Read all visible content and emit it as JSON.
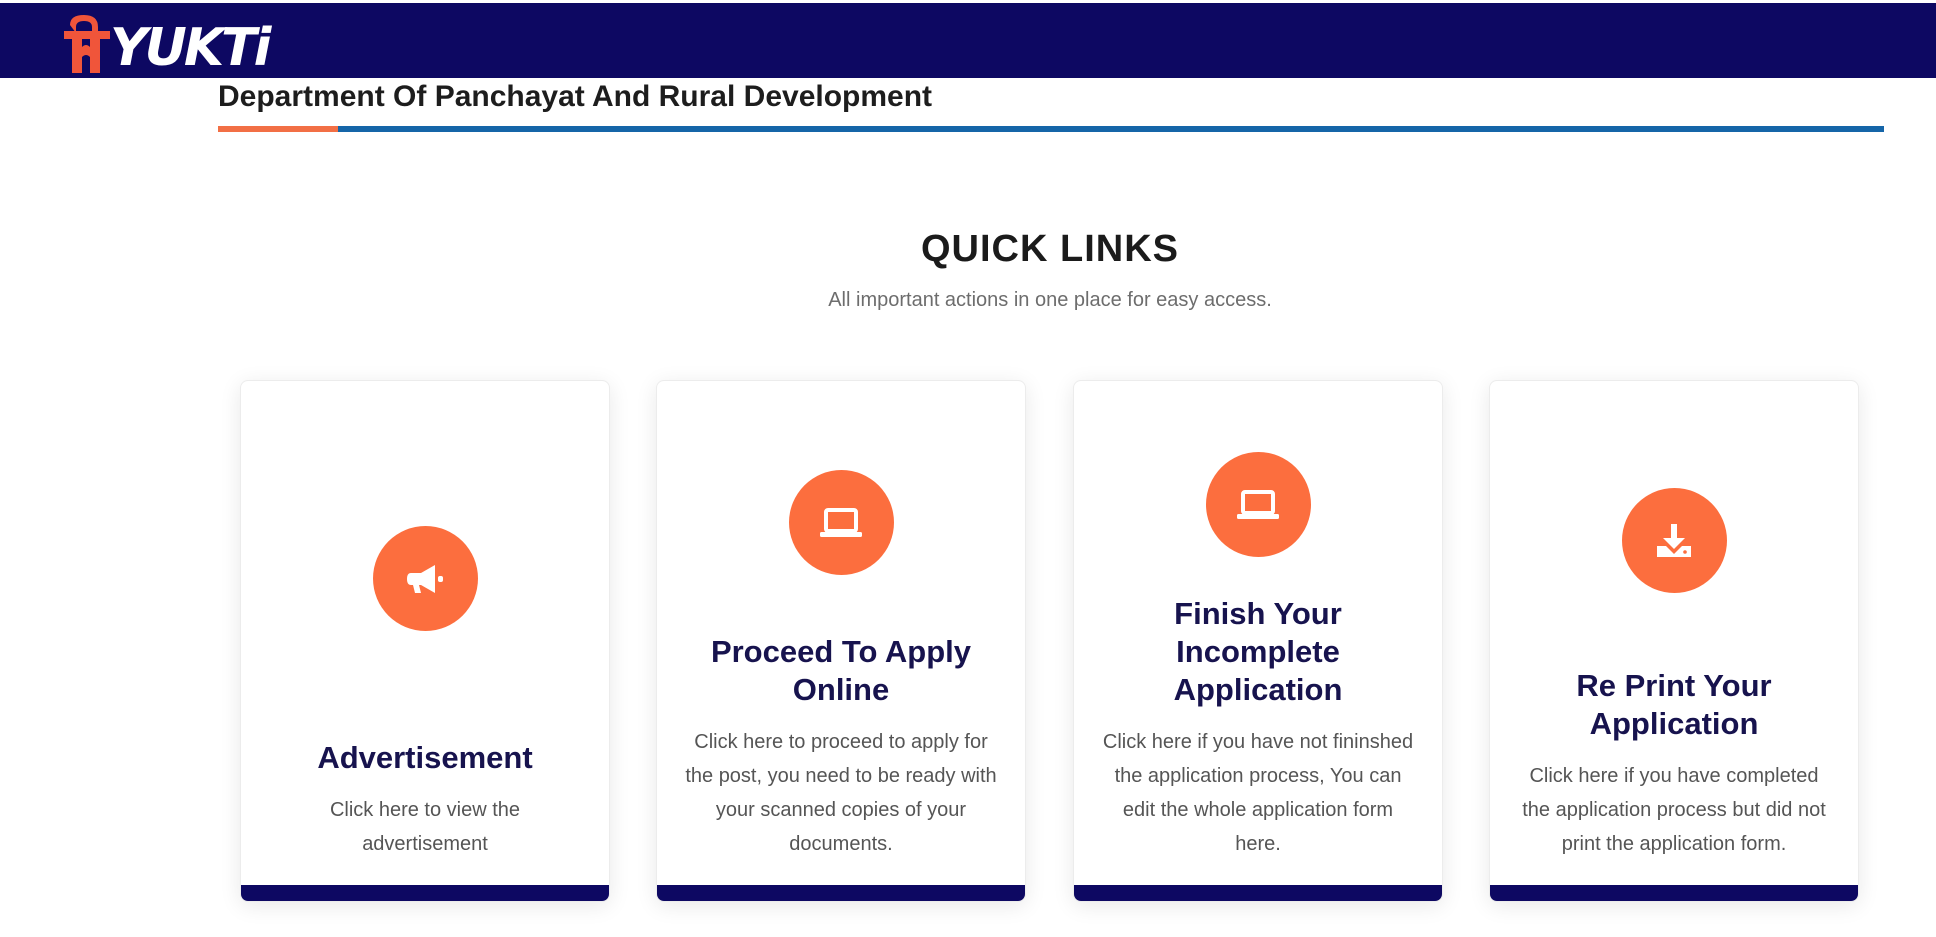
{
  "header": {
    "logo_text": "YUKTi",
    "department_title": "Department Of Panchayat And Rural Development"
  },
  "quick_links": {
    "title": "QUICK LINKS",
    "subtitle": "All important actions in one place for easy access.",
    "cards": [
      {
        "icon": "megaphone-icon",
        "title": "Advertisement",
        "description": "Click here to view the advertisement"
      },
      {
        "icon": "laptop-icon",
        "title": "Proceed To Apply Online",
        "description": "Click here to proceed to apply for the post, you need to be ready with your scanned copies of your documents."
      },
      {
        "icon": "laptop-icon",
        "title": "Finish Your Incomplete Application",
        "description": "Click here if you have not fininshed the application process, You can edit the whole application form here."
      },
      {
        "icon": "download-icon",
        "title": "Re Print Your Application",
        "description": "Click here if you have completed the application process but did not print the application form."
      }
    ]
  },
  "colors": {
    "navy": "#0d0862",
    "orange": "#fc6e3e",
    "blue_divider": "#1565a8",
    "card_title": "#17134e"
  }
}
